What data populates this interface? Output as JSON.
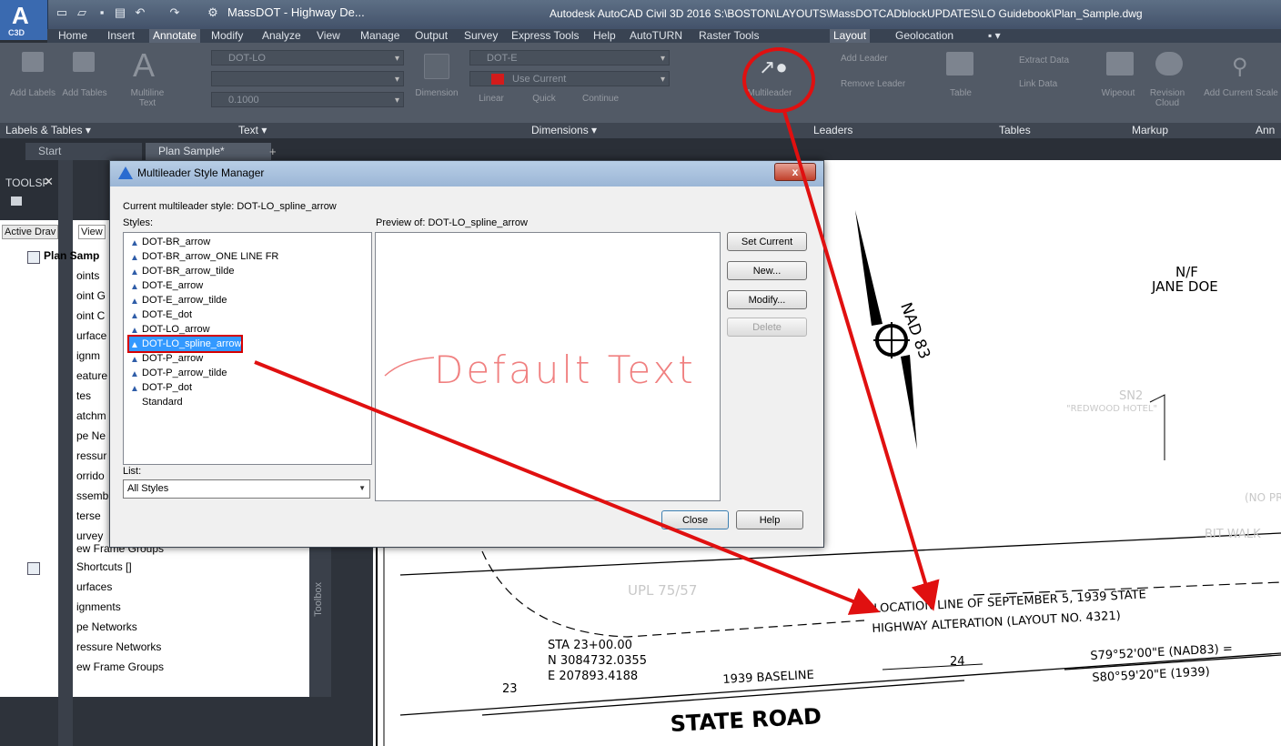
{
  "app": {
    "logo_letter": "A",
    "logo_sub": "C3D",
    "doc_title": "MassDOT - Highway De...",
    "window_title": "Autodesk AutoCAD Civil 3D 2016   S:\\BOSTON\\LAYOUTS\\MassDOTCADblockUPDATES\\LO Guidebook\\Plan_Sample.dwg"
  },
  "ribbon_tabs": [
    "Home",
    "Insert",
    "Annotate",
    "Modify",
    "Analyze",
    "View",
    "Manage",
    "Output",
    "Survey",
    "Express Tools",
    "Help",
    "AutoTURN",
    "Raster Tools",
    "Layout",
    "Geolocation"
  ],
  "ribbon": {
    "add_labels": "Add Labels",
    "add_tables": "Add Tables",
    "multiline_text": "Multiline Text",
    "text_style": "DOT-LO",
    "text_height": "0.1000",
    "dimension": "Dimension",
    "dim_style": "DOT-E",
    "use_current": "Use Current",
    "linear": "Linear",
    "quick": "Quick",
    "continue": "Continue",
    "multileader": "Multileader",
    "add_leader": "Add Leader",
    "remove_leader": "Remove Leader",
    "table": "Table",
    "extract_data": "Extract Data",
    "link_data": "Link Data",
    "wipeout": "Wipeout",
    "revision_cloud": "Revision Cloud",
    "add_current_scale": "Add Current Scale"
  },
  "panel_labels": {
    "labels_tables": "Labels & Tables ▾",
    "text": "Text ▾",
    "dimensions": "Dimensions ▾",
    "leaders": "Leaders",
    "tables": "Tables",
    "markup": "Markup",
    "annotation": "Ann"
  },
  "file_tabs": [
    "Start",
    "Plan Sample*"
  ],
  "toolspace": {
    "title": "TOOLSP",
    "tab_active": "Active Drav",
    "tab_view": "View",
    "tree": [
      "Plan Samp",
      "oints",
      "oint G",
      "oint C",
      "urface",
      "ignm",
      "eature",
      "tes",
      "atchm",
      "pe Ne",
      "ressur",
      "orrido",
      "ssemb",
      "terse",
      "urvey",
      "ew Frame Groups",
      "Shortcuts []",
      "urfaces",
      "ignments",
      "pe Networks",
      "ressure Networks",
      "ew Frame Groups"
    ],
    "toolbox": "Toolbox"
  },
  "dialog": {
    "title": "Multileader Style Manager",
    "current_style_label": "Current multileader style: DOT-LO_spline_arrow",
    "styles_label": "Styles:",
    "preview_label": "Preview of: DOT-LO_spline_arrow",
    "styles": [
      "DOT-BR_arrow",
      "DOT-BR_arrow_ONE LINE FR",
      "DOT-BR_arrow_tilde",
      "DOT-E_arrow",
      "DOT-E_arrow_tilde",
      "DOT-E_dot",
      "DOT-LO_arrow",
      "DOT-LO_spline_arrow",
      "DOT-P_arrow",
      "DOT-P_arrow_tilde",
      "DOT-P_dot",
      "Standard"
    ],
    "selected_style": "DOT-LO_spline_arrow",
    "list_label": "List:",
    "list_value": "All Styles",
    "preview_text": "Default Text",
    "buttons": {
      "set_current": "Set Current",
      "new": "New...",
      "modify": "Modify...",
      "delete": "Delete",
      "close": "Close",
      "help": "Help"
    },
    "close_x": "x"
  },
  "drawing": {
    "nad": "NAD 83",
    "nf": "N/F",
    "owner": "JANE DOE",
    "location_line1": "LOCATION LINE OF SEPTEMBER 5, 1939 STATE",
    "location_line2": "HIGHWAY ALTERATION (LAYOUT NO. 4321)",
    "sta": "STA 23+00.00",
    "northing": "N 3084732.0355",
    "easting": "E 207893.4188",
    "baseline": "1939 BASELINE",
    "sta_24": "24",
    "sta_23": "23",
    "bearing1": "S79°52'00\"E (NAD83) =",
    "bearing2": "S80°59'20\"E (1939)",
    "road": "STATE ROAD",
    "upl": "UPL 75/57",
    "sn2": "SN2",
    "hotel": "\"REDWOOD HOTEL\"",
    "bit_walk": "BIT WALK",
    "no_pr": "(NO PR"
  },
  "colors": {
    "annotation_red": "#e01010"
  }
}
